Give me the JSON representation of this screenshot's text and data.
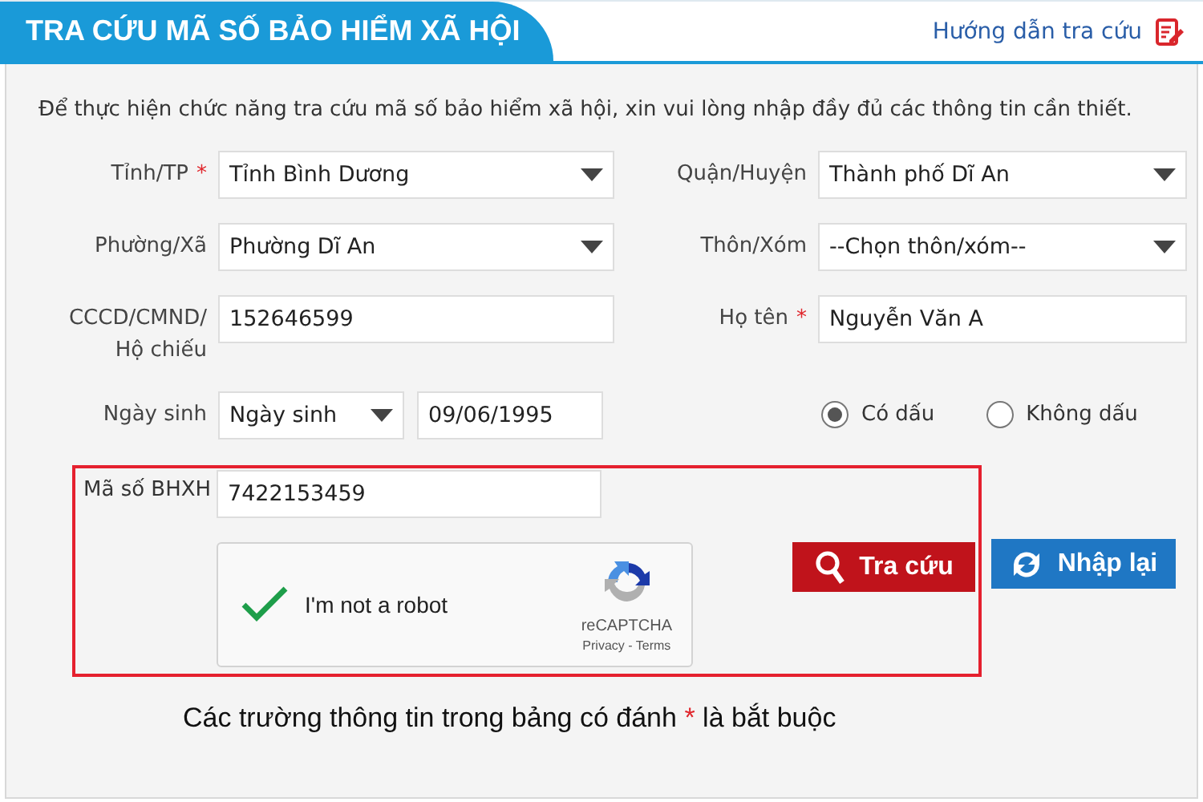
{
  "header": {
    "title": "TRA CỨU MÃ SỐ BẢO HIỂM XÃ HỘI",
    "help_link": "Hướng dẫn tra cứu"
  },
  "intro": "Để thực hiện chức năng tra cứu mã số bảo hiểm xã hội, xin vui lòng nhập đầy đủ các thông tin cần thiết.",
  "required_mark": "*",
  "fields": [
    {
      "kind": "select",
      "label": "Tỉnh/TP",
      "required": true,
      "value": "Tỉnh Bình Dương"
    },
    {
      "kind": "select",
      "label": "Quận/Huyện",
      "required": false,
      "value": "Thành phố Dĩ An"
    },
    {
      "kind": "select",
      "label": "Phường/Xã",
      "required": false,
      "value": "Phường Dĩ An"
    },
    {
      "kind": "select",
      "label": "Thôn/Xóm",
      "required": false,
      "value": "--Chọn thôn/xóm--"
    },
    {
      "kind": "text",
      "label": "CCCD/CMND/ Hộ chiếu",
      "required": false,
      "value": "152646599"
    },
    {
      "kind": "text",
      "label": "Họ tên",
      "required": true,
      "value": "Nguyễn Văn A"
    },
    {
      "kind": "date",
      "label": "Ngày sinh",
      "required": false,
      "format": "Ngày sinh",
      "value": "09/06/1995"
    },
    {
      "kind": "radios",
      "options": [
        {
          "label": "Có dấu",
          "selected": true
        },
        {
          "label": "Không dấu",
          "selected": false
        }
      ]
    }
  ],
  "bhxh": {
    "label": "Mã số BHXH",
    "value": "7422153459"
  },
  "captcha": {
    "label": "I'm not a robot",
    "checked": true,
    "brand": "reCAPTCHA",
    "links": "Privacy - Terms"
  },
  "buttons": [
    {
      "kind": "search",
      "label": "Tra cứu"
    },
    {
      "kind": "reset",
      "label": "Nhập lại"
    }
  ],
  "note": {
    "before": "Các trường thông tin trong bảng có đánh",
    "after": "là bắt buộc"
  }
}
